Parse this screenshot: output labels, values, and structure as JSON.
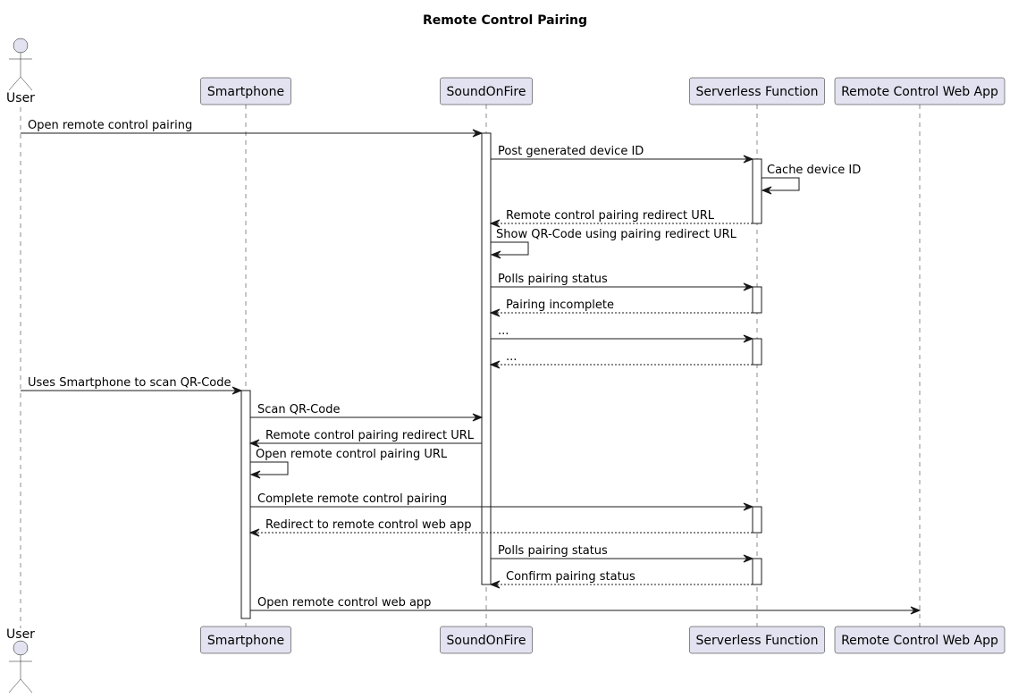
{
  "diagram": {
    "type": "sequence",
    "title": "Remote Control Pairing",
    "colors": {
      "participant_fill": "#E2E2F0",
      "line": "#181818",
      "activation_fill": "#FFFFFF",
      "background": "#FFFFFF"
    },
    "participants": [
      {
        "id": "user",
        "label": "User",
        "kind": "actor"
      },
      {
        "id": "smartphone",
        "label": "Smartphone",
        "kind": "participant"
      },
      {
        "id": "soundonfire",
        "label": "SoundOnFire",
        "kind": "participant"
      },
      {
        "id": "serverless",
        "label": "Serverless Function",
        "kind": "participant"
      },
      {
        "id": "webapp",
        "label": "Remote Control Web App",
        "kind": "participant"
      }
    ],
    "messages": [
      {
        "from": "user",
        "to": "soundonfire",
        "label": "Open remote control pairing",
        "style": "solid"
      },
      {
        "from": "soundonfire",
        "to": "serverless",
        "label": "Post generated device ID",
        "style": "solid"
      },
      {
        "from": "serverless",
        "to": "serverless",
        "label": "Cache device ID",
        "style": "solid"
      },
      {
        "from": "serverless",
        "to": "soundonfire",
        "label": "Remote control pairing redirect URL",
        "style": "dashed"
      },
      {
        "from": "soundonfire",
        "to": "soundonfire",
        "label": "Show QR-Code using pairing redirect URL",
        "style": "solid"
      },
      {
        "from": "soundonfire",
        "to": "serverless",
        "label": "Polls pairing status",
        "style": "solid"
      },
      {
        "from": "serverless",
        "to": "soundonfire",
        "label": "Pairing incomplete",
        "style": "dashed"
      },
      {
        "from": "soundonfire",
        "to": "serverless",
        "label": "...",
        "style": "solid"
      },
      {
        "from": "serverless",
        "to": "soundonfire",
        "label": "...",
        "style": "dashed"
      },
      {
        "from": "user",
        "to": "smartphone",
        "label": "Uses Smartphone to scan QR-Code",
        "style": "solid"
      },
      {
        "from": "smartphone",
        "to": "soundonfire",
        "label": "Scan QR-Code",
        "style": "solid"
      },
      {
        "from": "soundonfire",
        "to": "smartphone",
        "label": "Remote control pairing redirect URL",
        "style": "solid"
      },
      {
        "from": "smartphone",
        "to": "smartphone",
        "label": "Open remote control pairing URL",
        "style": "solid"
      },
      {
        "from": "smartphone",
        "to": "serverless",
        "label": "Complete remote control pairing",
        "style": "solid"
      },
      {
        "from": "serverless",
        "to": "smartphone",
        "label": "Redirect to remote control web app",
        "style": "dashed"
      },
      {
        "from": "soundonfire",
        "to": "serverless",
        "label": "Polls pairing status",
        "style": "solid"
      },
      {
        "from": "serverless",
        "to": "soundonfire",
        "label": "Confirm pairing status",
        "style": "dashed"
      },
      {
        "from": "smartphone",
        "to": "webapp",
        "label": "Open remote control web app",
        "style": "solid"
      }
    ],
    "activations": [
      {
        "participant": "soundonfire",
        "from_message": 0,
        "to_message": 16
      },
      {
        "participant": "serverless",
        "from_message": 1,
        "to_message": 3
      },
      {
        "participant": "serverless",
        "from_message": 5,
        "to_message": 6
      },
      {
        "participant": "serverless",
        "from_message": 7,
        "to_message": 8
      },
      {
        "participant": "smartphone",
        "from_message": 9,
        "to_message": 17
      },
      {
        "participant": "serverless",
        "from_message": 13,
        "to_message": 14
      },
      {
        "participant": "serverless",
        "from_message": 15,
        "to_message": 16
      }
    ]
  }
}
